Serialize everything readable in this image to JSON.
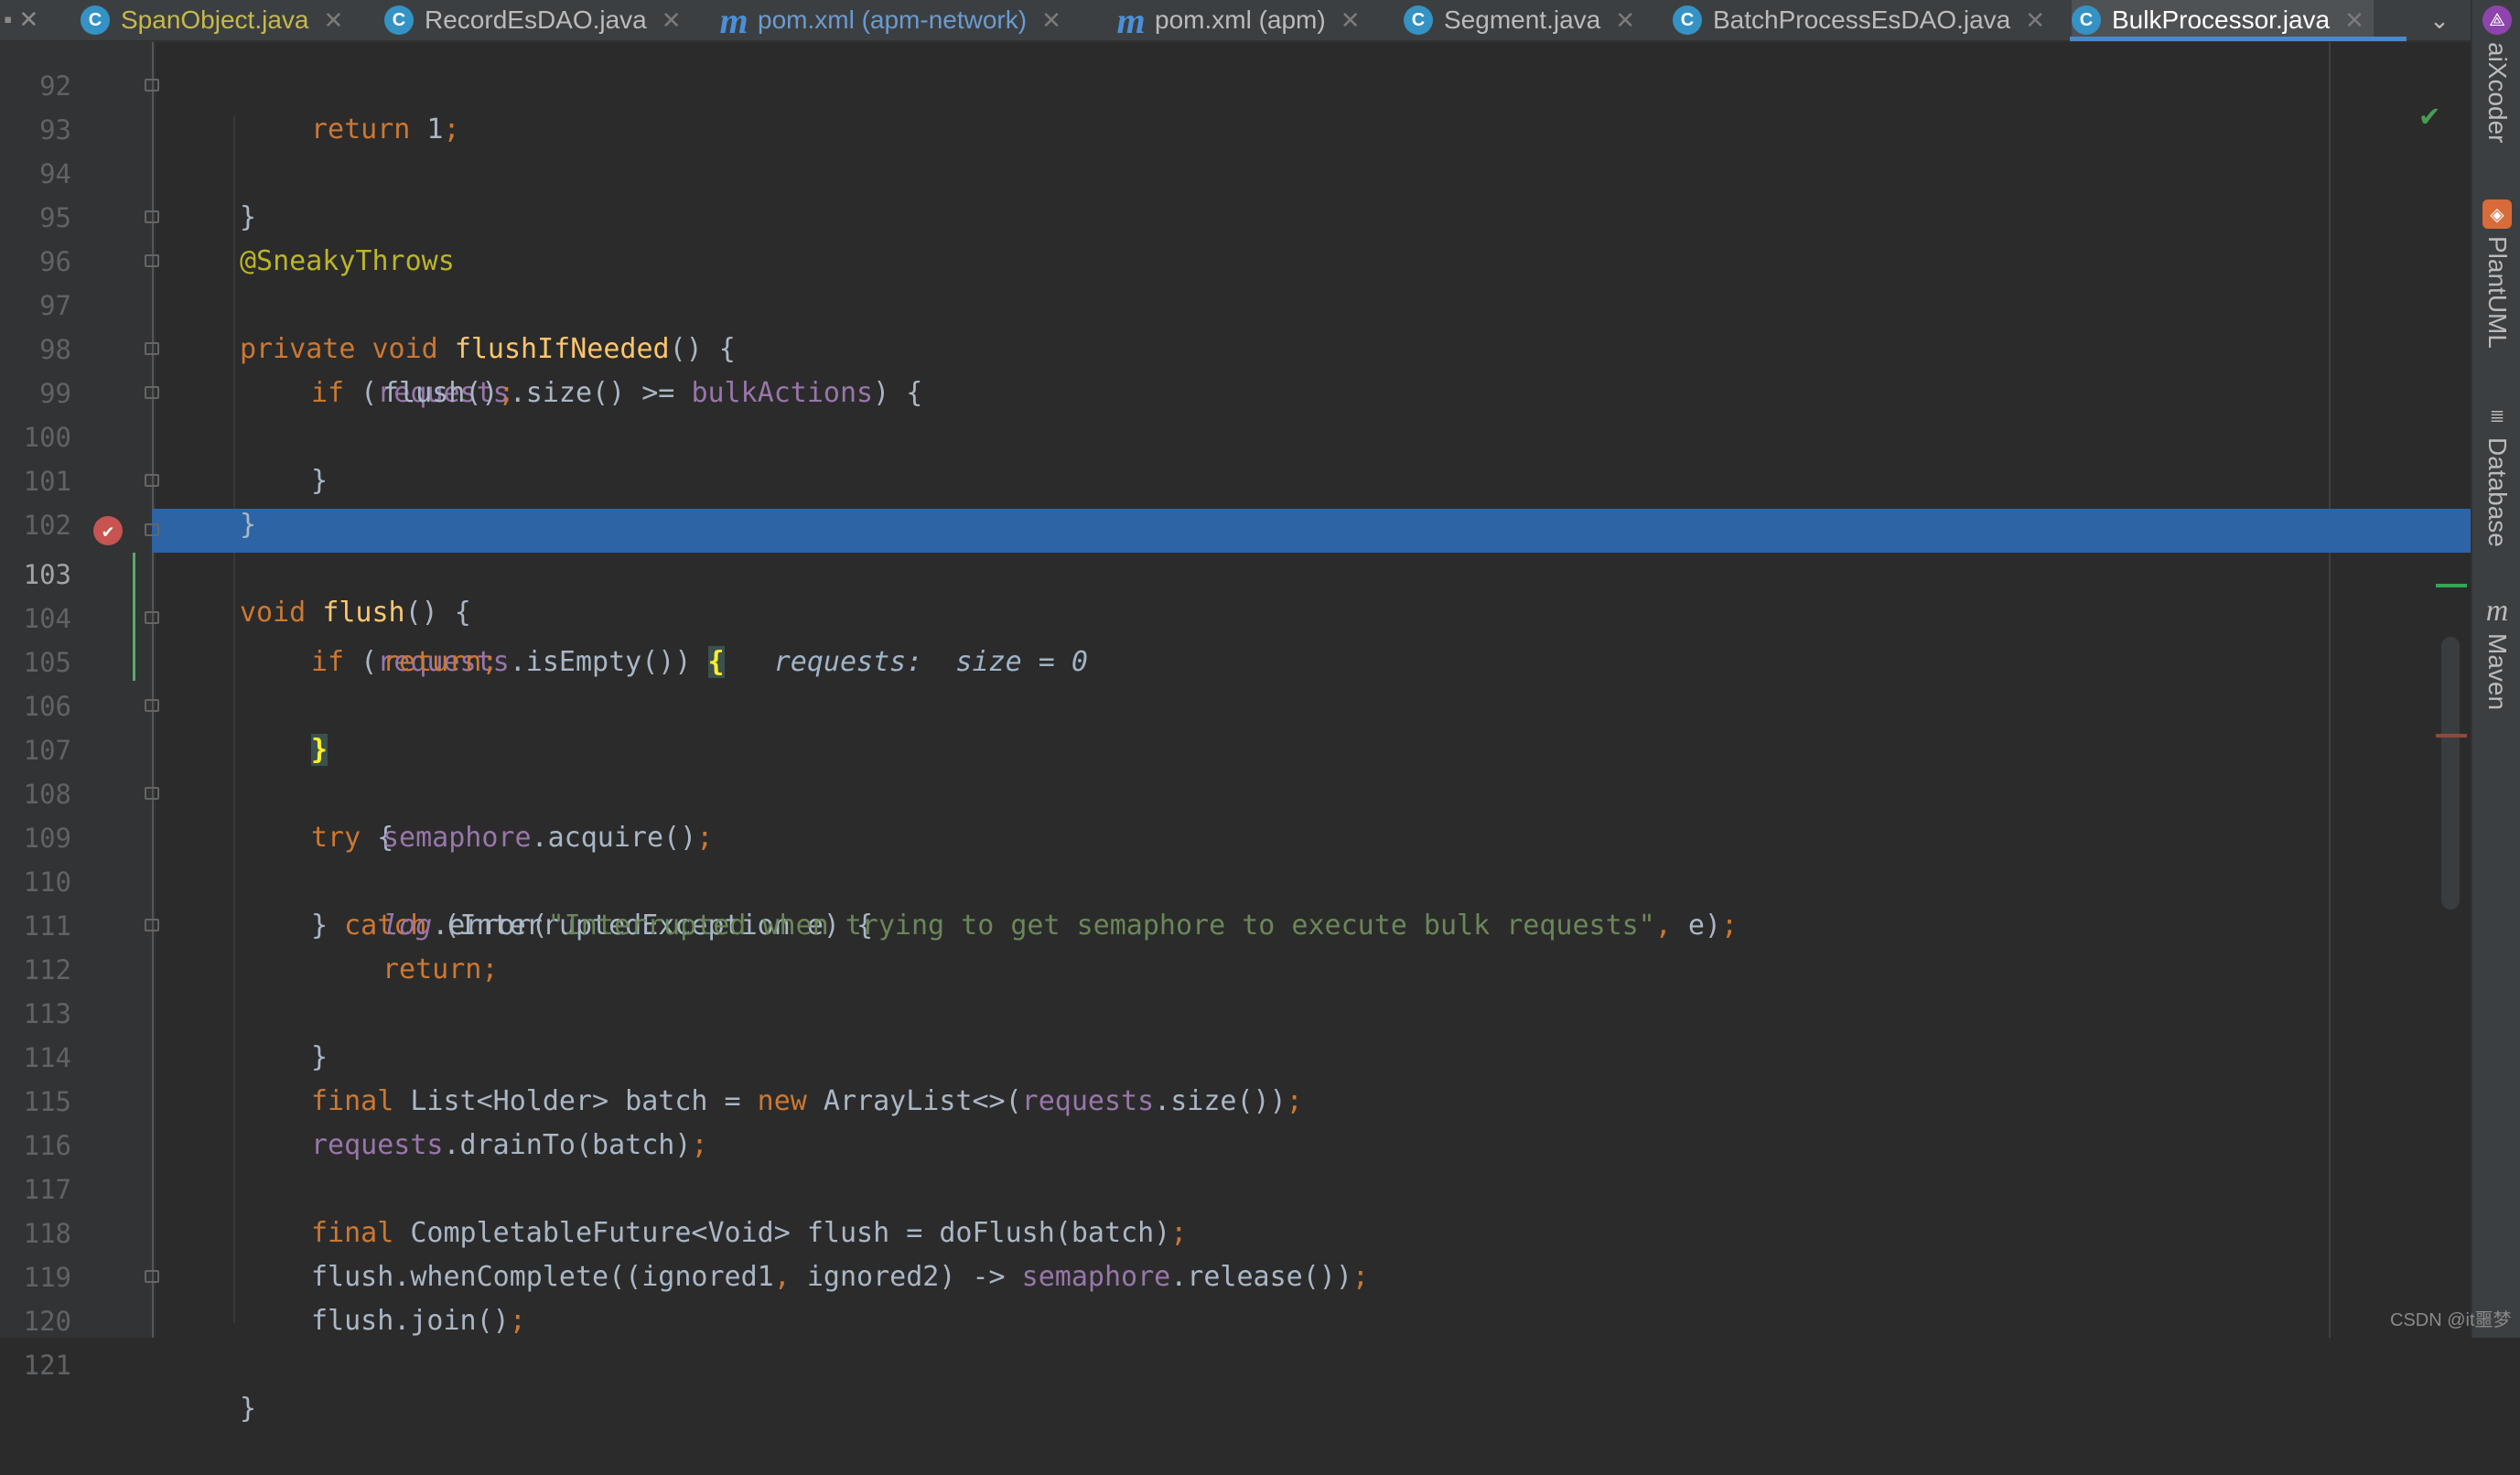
{
  "tabs": [
    {
      "label": "SpanObject.java",
      "icon": "c-class-icon",
      "color": "#c6b94a",
      "active": false
    },
    {
      "label": "RecordEsDAO.java",
      "icon": "c-class-icon",
      "color": "#bbbbbb",
      "active": false
    },
    {
      "label": "pom.xml (apm-network)",
      "icon": "maven-icon",
      "color": "#6b9bd1",
      "active": false
    },
    {
      "label": "pom.xml (apm)",
      "icon": "maven-icon",
      "color": "#bbbbbb",
      "active": false
    },
    {
      "label": "Segment.java",
      "icon": "c-class-icon",
      "color": "#bbbbbb",
      "active": false
    },
    {
      "label": "BatchProcessEsDAO.java",
      "icon": "c-class-icon",
      "color": "#bbbbbb",
      "active": false
    },
    {
      "label": "BulkProcessor.java",
      "icon": "c-class-icon",
      "color": "#ffffff",
      "active": true
    }
  ],
  "editor": {
    "current_line": 103,
    "lines": [
      {
        "n": "92"
      },
      {
        "n": "93"
      },
      {
        "n": "94"
      },
      {
        "n": "95"
      },
      {
        "n": "96"
      },
      {
        "n": "97"
      },
      {
        "n": "98"
      },
      {
        "n": "99"
      },
      {
        "n": "100"
      },
      {
        "n": "101"
      },
      {
        "n": "102"
      },
      {
        "n": "103"
      },
      {
        "n": "104"
      },
      {
        "n": "105"
      },
      {
        "n": "106"
      },
      {
        "n": "107"
      },
      {
        "n": "108"
      },
      {
        "n": "109"
      },
      {
        "n": "110"
      },
      {
        "n": "111"
      },
      {
        "n": "112"
      },
      {
        "n": "113"
      },
      {
        "n": "114"
      },
      {
        "n": "115"
      },
      {
        "n": "116"
      },
      {
        "n": "117"
      },
      {
        "n": "118"
      },
      {
        "n": "119"
      },
      {
        "n": "120"
      },
      {
        "n": "121"
      }
    ],
    "code": {
      "return_kw": "return",
      "return_val": " 1",
      "semicolon": ";",
      "close_brace": "}",
      "annotation": "@SneakyThrows",
      "private_kw": "private",
      "void_kw": "void",
      "flushIfNeeded_name": "flushIfNeeded",
      "empty_params_open": "() {",
      "if_kw": "if",
      "paren_open": " (",
      "requests_field": "requests",
      "size_call": ".size() >= ",
      "bulkActions_field": "bulkActions",
      "paren_close_brace": ") {",
      "flush_call": "flush()",
      "flush_name": "flush",
      "isEmpty_call": ".isEmpty()) ",
      "open_brace": "{",
      "debug_hint": "requests:  size = 0",
      "try_kw": "try",
      "space_brace": " {",
      "semaphore_field": "semaphore",
      "acquire_call": ".acquire()",
      "catch_brace": "} ",
      "catch_kw": "catch",
      "catch_params": " (InterruptedException e) {",
      "log_field": "log",
      "error_call": ".error(",
      "error_message": "\"Interrupted when trying to get semaphore to execute bulk requests\"",
      "comma": ",",
      "error_tail": " e)",
      "final_kw": "final",
      "list_decl": " List<Holder> batch = ",
      "new_kw": "new",
      "arraylist": " ArrayList<>(",
      "size_close": ".size())",
      "drainTo_call": ".drainTo(batch)",
      "future_decl": " CompletableFuture<Void> flush = doFlush(batch)",
      "when_complete": "flush.whenComplete((ignored1",
      "ignored2_arrow": " ignored2) -> ",
      "release_call": ".release())",
      "join_call": "flush.join()"
    }
  },
  "tool_windows": [
    {
      "label": "aiXcoder",
      "icon": "aixcoder-icon",
      "color": "#8e44ad"
    },
    {
      "label": "PlantUML",
      "icon": "plantuml-icon",
      "color": "#d86b3a"
    },
    {
      "label": "Database",
      "icon": "database-icon",
      "color": "#bbbbbb"
    },
    {
      "label": "Maven",
      "icon": "maven-icon",
      "color": "#bbbbbb"
    }
  ],
  "watermark": "CSDN @it噩梦"
}
